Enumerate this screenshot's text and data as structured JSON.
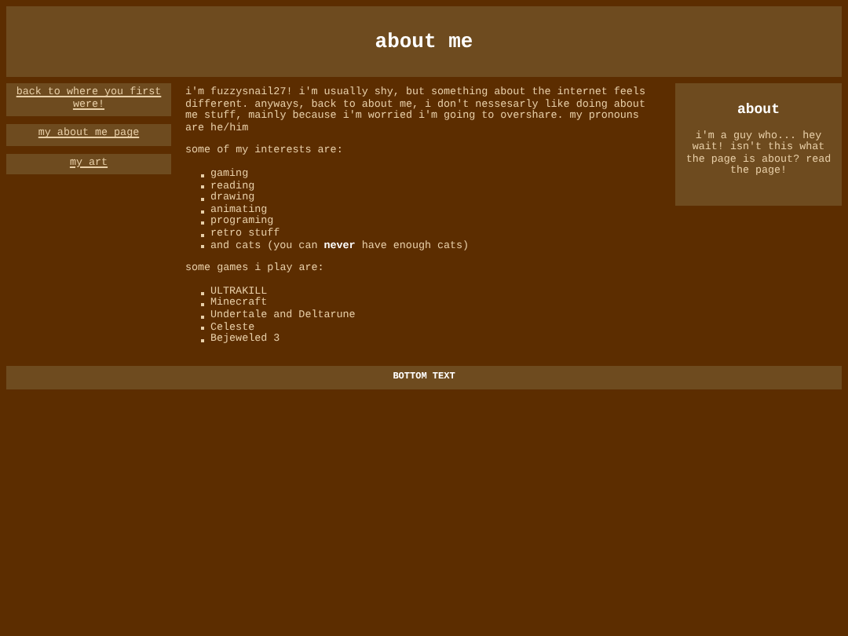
{
  "header": {
    "title": "about me"
  },
  "nav": [
    {
      "label": "back to where you first were!"
    },
    {
      "label": "my about me page"
    },
    {
      "label": "my art"
    }
  ],
  "main": {
    "intro": "i'm fuzzysnail27! i'm usually shy, but something about the internet feels different. anyways, back to about me, i don't nessesarly like doing about me stuff, mainly because i'm worried i'm going to overshare. my pronouns are he/him",
    "interests_heading": "some of my interests are:",
    "interests": [
      "gaming",
      "reading",
      "drawing",
      "animating",
      "programing",
      "retro stuff",
      "and cats (you can **never** have enough cats)"
    ],
    "games_heading": "some games i play are:",
    "games": [
      "ULTRAKILL",
      "Minecraft",
      "Undertale and Deltarune",
      "Celeste",
      "Bejeweled 3"
    ]
  },
  "aside": {
    "title": "about",
    "text": "i'm a guy who... hey wait! isn't this what the page is about? read the page!"
  },
  "footer": {
    "text": "BOTTOM TEXT"
  }
}
